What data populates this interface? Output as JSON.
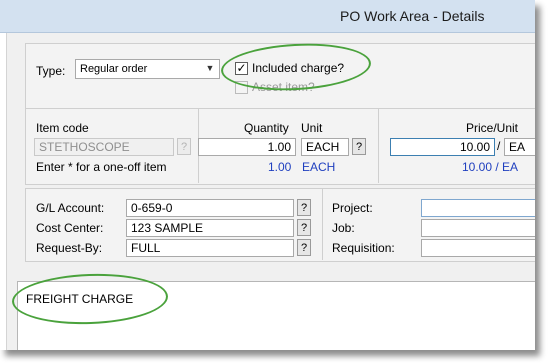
{
  "window": {
    "title": "PO Work Area - Details"
  },
  "type_section": {
    "type_label": "Type:",
    "type_value": "Regular order",
    "included_charge_label": "Included charge?",
    "included_charge_checked": true,
    "asset_item_label": "Asset item?",
    "asset_item_checked": false
  },
  "item_section": {
    "item_code_label": "Item code",
    "item_code_value": "STETHOSCOPE",
    "hint": "Enter * for a one-off item",
    "quantity_label": "Quantity",
    "quantity_value": "1.00",
    "quantity_secondary": "1.00",
    "unit_label": "Unit",
    "unit_value": "EACH",
    "unit_secondary": "EACH",
    "price_label": "Price/Unit",
    "price_value": "10.00",
    "price_separator": "/",
    "price_unit": "EA",
    "price_secondary": "10.00 / EA"
  },
  "accounting_section": {
    "gl_label": "G/L Account:",
    "gl_value": "0-659-0",
    "cost_center_label": "Cost Center:",
    "cost_center_value": "123 SAMPLE",
    "request_by_label": "Request-By:",
    "request_by_value": "FULL",
    "project_label": "Project:",
    "job_label": "Job:",
    "requisition_label": "Requisition:"
  },
  "description": {
    "text": "FREIGHT CHARGE"
  },
  "lookup_glyph": "?",
  "check_glyph": "✓",
  "dropdown_glyph": "▼",
  "colors": {
    "annotation": "#4aa23c",
    "secondary_text": "#1f3fbf",
    "titlebar": "#d3e1f0"
  }
}
